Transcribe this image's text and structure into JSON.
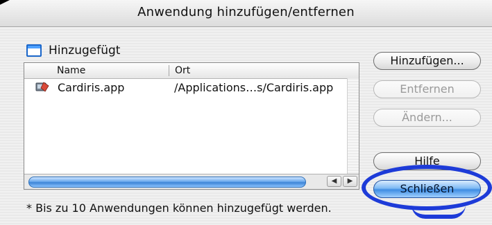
{
  "window": {
    "title": "Anwendung hinzufügen/entfernen"
  },
  "list": {
    "header": "Hinzugefügt",
    "columns": {
      "name": "Name",
      "ort": "Ort"
    },
    "rows": [
      {
        "name": "Cardiris.app",
        "ort": "/Applications…s/Cardiris.app"
      }
    ]
  },
  "buttons": {
    "add": "Hinzufügen...",
    "remove": "Entfernen",
    "change": "Ändern...",
    "help": "Hilfe",
    "close": "Schließen"
  },
  "footer": {
    "note": "* Bis zu 10 Anwendungen können hinzugefügt werden."
  },
  "colors": {
    "highlight": "#1d3bd8",
    "accent": "#3f8de3"
  }
}
